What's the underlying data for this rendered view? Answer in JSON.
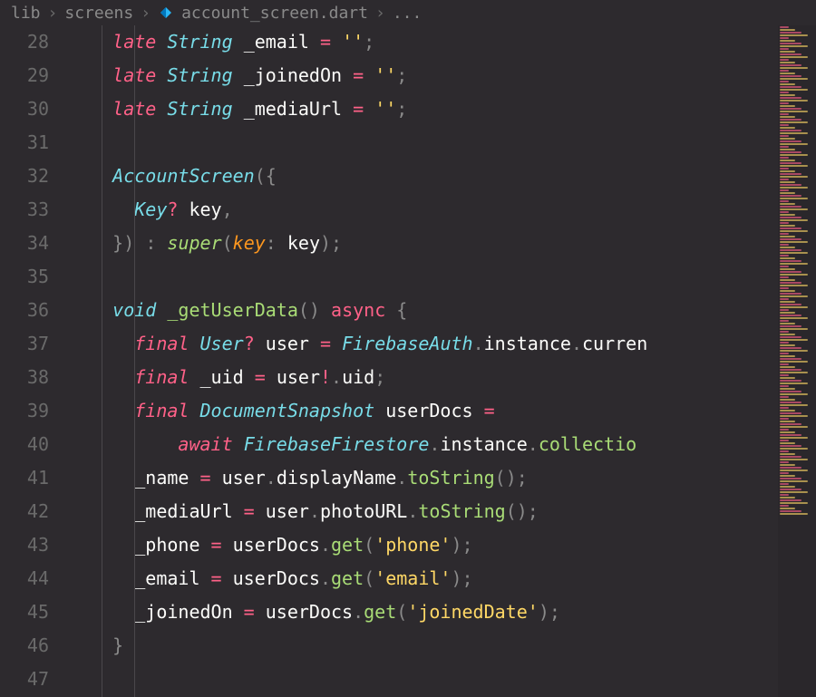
{
  "breadcrumb": {
    "part1": "lib",
    "part2": "screens",
    "file": "account_screen.dart",
    "trail": "..."
  },
  "gutter": {
    "start": 28,
    "end": 47
  },
  "code": {
    "lines": [
      [
        {
          "t": "    ",
          "c": ""
        },
        {
          "t": "late",
          "c": "tk-kw"
        },
        {
          "t": " ",
          "c": ""
        },
        {
          "t": "String",
          "c": "tk-type"
        },
        {
          "t": " ",
          "c": ""
        },
        {
          "t": "_email",
          "c": "tk-ident"
        },
        {
          "t": " ",
          "c": ""
        },
        {
          "t": "=",
          "c": "tk-op"
        },
        {
          "t": " ",
          "c": ""
        },
        {
          "t": "''",
          "c": "tk-str"
        },
        {
          "t": ";",
          "c": "tk-punc"
        }
      ],
      [
        {
          "t": "    ",
          "c": ""
        },
        {
          "t": "late",
          "c": "tk-kw"
        },
        {
          "t": " ",
          "c": ""
        },
        {
          "t": "String",
          "c": "tk-type"
        },
        {
          "t": " ",
          "c": ""
        },
        {
          "t": "_joinedOn",
          "c": "tk-ident"
        },
        {
          "t": " ",
          "c": ""
        },
        {
          "t": "=",
          "c": "tk-op"
        },
        {
          "t": " ",
          "c": ""
        },
        {
          "t": "''",
          "c": "tk-str"
        },
        {
          "t": ";",
          "c": "tk-punc"
        }
      ],
      [
        {
          "t": "    ",
          "c": ""
        },
        {
          "t": "late",
          "c": "tk-kw"
        },
        {
          "t": " ",
          "c": ""
        },
        {
          "t": "String",
          "c": "tk-type"
        },
        {
          "t": " ",
          "c": ""
        },
        {
          "t": "_mediaUrl",
          "c": "tk-ident"
        },
        {
          "t": " ",
          "c": ""
        },
        {
          "t": "=",
          "c": "tk-op"
        },
        {
          "t": " ",
          "c": ""
        },
        {
          "t": "''",
          "c": "tk-str"
        },
        {
          "t": ";",
          "c": "tk-punc"
        }
      ],
      [],
      [
        {
          "t": "    ",
          "c": ""
        },
        {
          "t": "AccountScreen",
          "c": "tk-type"
        },
        {
          "t": "({",
          "c": "tk-punc"
        }
      ],
      [
        {
          "t": "      ",
          "c": ""
        },
        {
          "t": "Key",
          "c": "tk-type"
        },
        {
          "t": "?",
          "c": "tk-op"
        },
        {
          "t": " ",
          "c": ""
        },
        {
          "t": "key",
          "c": "tk-ident"
        },
        {
          "t": ",",
          "c": "tk-punc"
        }
      ],
      [
        {
          "t": "    ",
          "c": ""
        },
        {
          "t": "})",
          "c": "tk-punc"
        },
        {
          "t": " ",
          "c": ""
        },
        {
          "t": ":",
          "c": "tk-punc"
        },
        {
          "t": " ",
          "c": ""
        },
        {
          "t": "super",
          "c": "tk-fnital"
        },
        {
          "t": "(",
          "c": "tk-punc"
        },
        {
          "t": "key",
          "c": "tk-param"
        },
        {
          "t": ":",
          "c": "tk-punc"
        },
        {
          "t": " ",
          "c": ""
        },
        {
          "t": "key",
          "c": "tk-ident"
        },
        {
          "t": ");",
          "c": "tk-punc"
        }
      ],
      [],
      [
        {
          "t": "    ",
          "c": ""
        },
        {
          "t": "void",
          "c": "tk-type"
        },
        {
          "t": " ",
          "c": ""
        },
        {
          "t": "_getUserData",
          "c": "tk-fn"
        },
        {
          "t": "()",
          "c": "tk-punc"
        },
        {
          "t": " ",
          "c": ""
        },
        {
          "t": "async",
          "c": "tk-kw-ni"
        },
        {
          "t": " ",
          "c": ""
        },
        {
          "t": "{",
          "c": "tk-punc"
        }
      ],
      [
        {
          "t": "      ",
          "c": ""
        },
        {
          "t": "final",
          "c": "tk-kw"
        },
        {
          "t": " ",
          "c": ""
        },
        {
          "t": "User",
          "c": "tk-type"
        },
        {
          "t": "?",
          "c": "tk-op"
        },
        {
          "t": " ",
          "c": ""
        },
        {
          "t": "user",
          "c": "tk-ident"
        },
        {
          "t": " ",
          "c": ""
        },
        {
          "t": "=",
          "c": "tk-op"
        },
        {
          "t": " ",
          "c": ""
        },
        {
          "t": "FirebaseAuth",
          "c": "tk-type"
        },
        {
          "t": ".",
          "c": "tk-punc"
        },
        {
          "t": "instance",
          "c": "tk-ident"
        },
        {
          "t": ".",
          "c": "tk-punc"
        },
        {
          "t": "curren",
          "c": "tk-ident"
        }
      ],
      [
        {
          "t": "      ",
          "c": ""
        },
        {
          "t": "final",
          "c": "tk-kw"
        },
        {
          "t": " ",
          "c": ""
        },
        {
          "t": "_uid",
          "c": "tk-ident"
        },
        {
          "t": " ",
          "c": ""
        },
        {
          "t": "=",
          "c": "tk-op"
        },
        {
          "t": " ",
          "c": ""
        },
        {
          "t": "user",
          "c": "tk-ident"
        },
        {
          "t": "!",
          "c": "tk-op"
        },
        {
          "t": ".",
          "c": "tk-punc"
        },
        {
          "t": "uid",
          "c": "tk-ident"
        },
        {
          "t": ";",
          "c": "tk-punc"
        }
      ],
      [
        {
          "t": "      ",
          "c": ""
        },
        {
          "t": "final",
          "c": "tk-kw"
        },
        {
          "t": " ",
          "c": ""
        },
        {
          "t": "DocumentSnapshot",
          "c": "tk-type"
        },
        {
          "t": " ",
          "c": ""
        },
        {
          "t": "userDocs",
          "c": "tk-ident"
        },
        {
          "t": " ",
          "c": ""
        },
        {
          "t": "=",
          "c": "tk-op"
        }
      ],
      [
        {
          "t": "          ",
          "c": ""
        },
        {
          "t": "await",
          "c": "tk-await"
        },
        {
          "t": " ",
          "c": ""
        },
        {
          "t": "FirebaseFirestore",
          "c": "tk-type"
        },
        {
          "t": ".",
          "c": "tk-punc"
        },
        {
          "t": "instance",
          "c": "tk-ident"
        },
        {
          "t": ".",
          "c": "tk-punc"
        },
        {
          "t": "collectio",
          "c": "tk-fn"
        }
      ],
      [
        {
          "t": "      ",
          "c": ""
        },
        {
          "t": "_name",
          "c": "tk-ident"
        },
        {
          "t": " ",
          "c": ""
        },
        {
          "t": "=",
          "c": "tk-op"
        },
        {
          "t": " ",
          "c": ""
        },
        {
          "t": "user",
          "c": "tk-ident"
        },
        {
          "t": ".",
          "c": "tk-punc"
        },
        {
          "t": "displayName",
          "c": "tk-ident"
        },
        {
          "t": ".",
          "c": "tk-punc"
        },
        {
          "t": "toString",
          "c": "tk-fn"
        },
        {
          "t": "();",
          "c": "tk-punc"
        }
      ],
      [
        {
          "t": "      ",
          "c": ""
        },
        {
          "t": "_mediaUrl",
          "c": "tk-ident"
        },
        {
          "t": " ",
          "c": ""
        },
        {
          "t": "=",
          "c": "tk-op"
        },
        {
          "t": " ",
          "c": ""
        },
        {
          "t": "user",
          "c": "tk-ident"
        },
        {
          "t": ".",
          "c": "tk-punc"
        },
        {
          "t": "photoURL",
          "c": "tk-ident"
        },
        {
          "t": ".",
          "c": "tk-punc"
        },
        {
          "t": "toString",
          "c": "tk-fn"
        },
        {
          "t": "();",
          "c": "tk-punc"
        }
      ],
      [
        {
          "t": "      ",
          "c": ""
        },
        {
          "t": "_phone",
          "c": "tk-ident"
        },
        {
          "t": " ",
          "c": ""
        },
        {
          "t": "=",
          "c": "tk-op"
        },
        {
          "t": " ",
          "c": ""
        },
        {
          "t": "userDocs",
          "c": "tk-ident"
        },
        {
          "t": ".",
          "c": "tk-punc"
        },
        {
          "t": "get",
          "c": "tk-fn"
        },
        {
          "t": "(",
          "c": "tk-punc"
        },
        {
          "t": "'phone'",
          "c": "tk-str"
        },
        {
          "t": ");",
          "c": "tk-punc"
        }
      ],
      [
        {
          "t": "      ",
          "c": ""
        },
        {
          "t": "_email",
          "c": "tk-ident"
        },
        {
          "t": " ",
          "c": ""
        },
        {
          "t": "=",
          "c": "tk-op"
        },
        {
          "t": " ",
          "c": ""
        },
        {
          "t": "userDocs",
          "c": "tk-ident"
        },
        {
          "t": ".",
          "c": "tk-punc"
        },
        {
          "t": "get",
          "c": "tk-fn"
        },
        {
          "t": "(",
          "c": "tk-punc"
        },
        {
          "t": "'email'",
          "c": "tk-str"
        },
        {
          "t": ");",
          "c": "tk-punc"
        }
      ],
      [
        {
          "t": "      ",
          "c": ""
        },
        {
          "t": "_joinedOn",
          "c": "tk-ident"
        },
        {
          "t": " ",
          "c": ""
        },
        {
          "t": "=",
          "c": "tk-op"
        },
        {
          "t": " ",
          "c": ""
        },
        {
          "t": "userDocs",
          "c": "tk-ident"
        },
        {
          "t": ".",
          "c": "tk-punc"
        },
        {
          "t": "get",
          "c": "tk-fn"
        },
        {
          "t": "(",
          "c": "tk-punc"
        },
        {
          "t": "'joinedDate'",
          "c": "tk-str"
        },
        {
          "t": ");",
          "c": "tk-punc"
        }
      ],
      [
        {
          "t": "    ",
          "c": ""
        },
        {
          "t": "}",
          "c": "tk-punc"
        }
      ],
      []
    ]
  },
  "minimap": {
    "colors": [
      "#ff6188",
      "#78dce8",
      "#a9dc76",
      "#ffd866",
      "#fcfcfa",
      "#8a8a8a"
    ]
  }
}
